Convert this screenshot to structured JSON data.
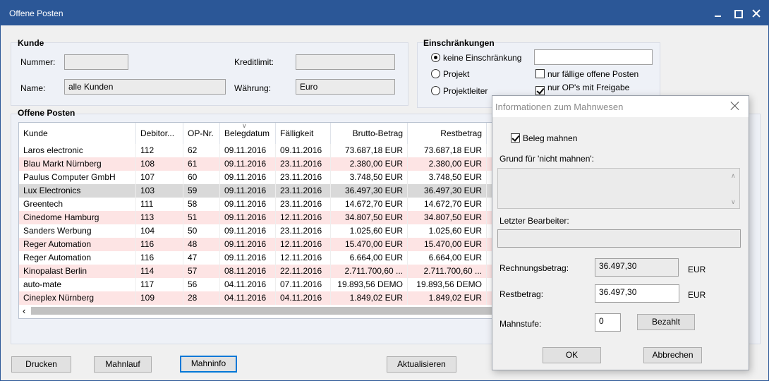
{
  "window": {
    "title": "Offene Posten"
  },
  "kunde": {
    "label": "Kunde",
    "nummer_label": "Nummer:",
    "nummer_value": "",
    "name_label": "Name:",
    "name_value": "alle Kunden",
    "kreditlimit_label": "Kreditlimit:",
    "kreditlimit_value": "",
    "waehrung_label": "Währung:",
    "waehrung_value": "Euro"
  },
  "einschraenkungen": {
    "label": "Einschränkungen",
    "options": [
      "keine Einschränkung",
      "Projekt",
      "Projektleiter"
    ],
    "selected": 0,
    "filter_value": "",
    "checks": [
      {
        "label": "nur fällige offene Posten",
        "checked": false
      },
      {
        "label": "nur OP's mit Freigabe",
        "checked": true
      }
    ]
  },
  "op": {
    "label": "Offene Posten",
    "columns": [
      "Kunde",
      "Debitor...",
      "OP-Nr.",
      "Belegdatum",
      "Fälligkeit",
      "Brutto-Betrag",
      "Restbetrag"
    ],
    "rows": [
      [
        "Laros electronic",
        "112",
        "62",
        "09.11.2016",
        "09.11.2016",
        "73.687,18 EUR",
        "73.687,18 EUR"
      ],
      [
        "Blau Markt Nürnberg",
        "108",
        "61",
        "09.11.2016",
        "23.11.2016",
        "2.380,00 EUR",
        "2.380,00 EUR"
      ],
      [
        "Paulus Computer GmbH",
        "107",
        "60",
        "09.11.2016",
        "23.11.2016",
        "3.748,50 EUR",
        "3.748,50 EUR"
      ],
      [
        "Lux Electronics",
        "103",
        "59",
        "09.11.2016",
        "23.11.2016",
        "36.497,30 EUR",
        "36.497,30 EUR"
      ],
      [
        "Greentech",
        "111",
        "58",
        "09.11.2016",
        "23.11.2016",
        "14.672,70 EUR",
        "14.672,70 EUR"
      ],
      [
        "Cinedome Hamburg",
        "113",
        "51",
        "09.11.2016",
        "12.11.2016",
        "34.807,50 EUR",
        "34.807,50 EUR"
      ],
      [
        "Sanders Werbung",
        "104",
        "50",
        "09.11.2016",
        "23.11.2016",
        "1.025,60 EUR",
        "1.025,60 EUR"
      ],
      [
        "Reger Automation",
        "116",
        "48",
        "09.11.2016",
        "12.11.2016",
        "15.470,00 EUR",
        "15.470,00 EUR"
      ],
      [
        "Reger Automation",
        "116",
        "47",
        "09.11.2016",
        "12.11.2016",
        "6.664,00 EUR",
        "6.664,00 EUR"
      ],
      [
        "Kinopalast Berlin",
        "114",
        "57",
        "08.11.2016",
        "22.11.2016",
        "2.711.700,60 ...",
        "2.711.700,60 ..."
      ],
      [
        "auto-mate",
        "117",
        "56",
        "04.11.2016",
        "07.11.2016",
        "19.893,56 DEMO",
        "19.893,56 DEMO"
      ],
      [
        "Cineplex Nürnberg",
        "109",
        "28",
        "04.11.2016",
        "04.11.2016",
        "1.849,02 EUR",
        "1.849,02 EUR"
      ]
    ],
    "row_styles": [
      "white",
      "pink",
      "white",
      "selected",
      "white",
      "pink",
      "white",
      "pink",
      "white",
      "pink",
      "white",
      "pink"
    ]
  },
  "buttons": {
    "drucken": "Drucken",
    "mahnlauf": "Mahnlauf",
    "mahninfo": "Mahninfo",
    "aktualisieren": "Aktualisieren"
  },
  "dialog": {
    "title": "Informationen zum Mahnwesen",
    "beleg_mahnen_label": "Beleg mahnen",
    "beleg_mahnen_checked": true,
    "grund_label": "Grund für 'nicht mahnen':",
    "letzter_label": "Letzter Bearbeiter:",
    "letzter_value": "",
    "rechnung_label": "Rechnungsbetrag:",
    "rechnung_value": "36.497,30",
    "rest_label": "Restbetrag:",
    "rest_value": "36.497,30",
    "currency": "EUR",
    "mahnstufe_label": "Mahnstufe:",
    "mahnstufe_value": "0",
    "bezahlt": "Bezahlt",
    "ok": "OK",
    "abbrechen": "Abbrechen"
  },
  "colors": {
    "titlebar": "#2b5797",
    "row_pink": "#fde4e4",
    "row_selected": "#d9d9d9",
    "focus_border": "#0078d7"
  }
}
